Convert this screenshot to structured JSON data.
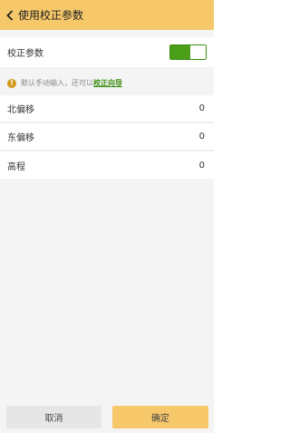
{
  "header": {
    "title": "使用校正参数",
    "back_icon": "chevron-left-icon"
  },
  "settings": {
    "correction_label": "校正参数",
    "correction_enabled": true
  },
  "hint": {
    "icon": "info-icon",
    "text": "默认手动输入，还可以",
    "link": "校正向导"
  },
  "params": [
    {
      "label": "北偏移",
      "value": "0"
    },
    {
      "label": "东偏移",
      "value": "0"
    },
    {
      "label": "高程",
      "value": "0"
    }
  ],
  "footer": {
    "cancel_label": "取消",
    "confirm_label": "确定"
  },
  "colors": {
    "header": "#f6c86a",
    "toggle_on": "#4a9e18",
    "link": "#3a8e12",
    "info": "#d19a1a"
  }
}
